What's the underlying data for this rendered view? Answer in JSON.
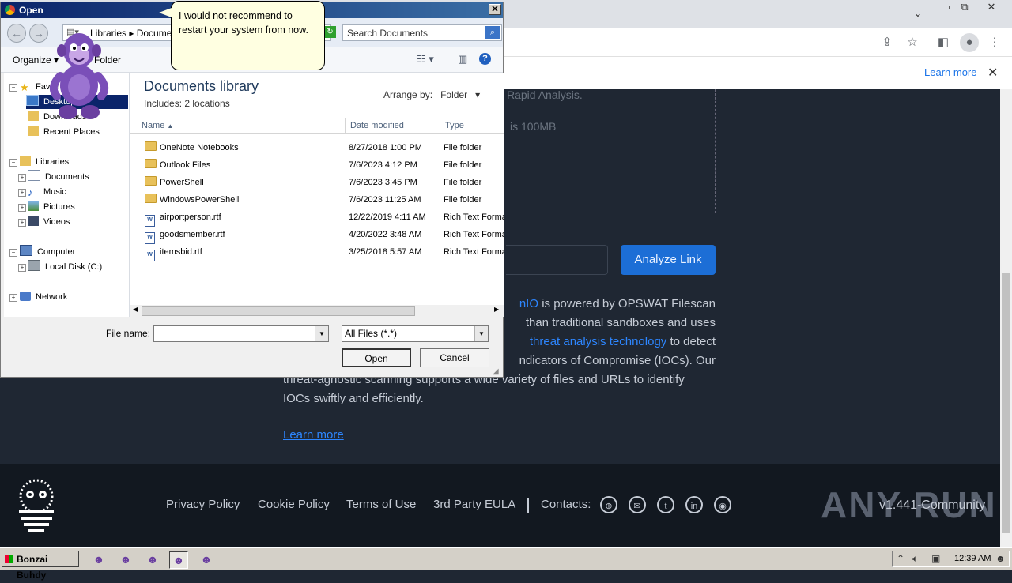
{
  "browser": {
    "banner_link": "Learn more"
  },
  "page": {
    "drop_text_1": "Rapid Analysis.",
    "drop_text_2": "is 100MB",
    "analyze_button": "Analyze Link",
    "para_line1_link": "nIO",
    "para_line1_rest": " is powered by OPSWAT Filescan",
    "para_line2": "than traditional sandboxes and uses",
    "para_line3_link": "threat analysis technology",
    "para_line3_rest": " to detect",
    "para_line4": "ndicators of Compromise (IOCs). Our",
    "para_line5": "threat-agnostic scanning supports a wide variety of files and URLs to identify",
    "para_line6": "IOCs swiftly and efficiently.",
    "learn_more": "Learn more"
  },
  "footer": {
    "links": [
      "Privacy Policy",
      "Cookie Policy",
      "Terms of Use",
      "3rd Party EULA"
    ],
    "contacts_label": "Contacts:",
    "brand": "ANY RUN",
    "version": "v1.441-Community"
  },
  "dialog": {
    "title": "Open",
    "breadcrumb": "Libraries ▸ Documents",
    "search_placeholder": "Search Documents",
    "organize": "Organize ▾",
    "new_folder": "Folder",
    "library_title": "Documents library",
    "library_sub": "Includes:  2 locations",
    "arrange_label": "Arrange by:",
    "arrange_value": "Folder",
    "columns": [
      "Name",
      "Date modified",
      "Type"
    ],
    "files": [
      {
        "name": "OneNote Notebooks",
        "date": "8/27/2018 1:00 PM",
        "type": "File folder",
        "kind": "folder"
      },
      {
        "name": "Outlook Files",
        "date": "7/6/2023 4:12 PM",
        "type": "File folder",
        "kind": "folder"
      },
      {
        "name": "PowerShell",
        "date": "7/6/2023 3:45 PM",
        "type": "File folder",
        "kind": "folder"
      },
      {
        "name": "WindowsPowerShell",
        "date": "7/6/2023 11:25 AM",
        "type": "File folder",
        "kind": "folder"
      },
      {
        "name": "airportperson.rtf",
        "date": "12/22/2019 4:11 AM",
        "type": "Rich Text Forma",
        "kind": "rtf"
      },
      {
        "name": "goodsmember.rtf",
        "date": "4/20/2022 3:48 AM",
        "type": "Rich Text Forma",
        "kind": "rtf"
      },
      {
        "name": "itemsbid.rtf",
        "date": "3/25/2018 5:57 AM",
        "type": "Rich Text Forma",
        "kind": "rtf"
      }
    ],
    "tree": {
      "favorites": "Favorites",
      "desktop": "Desktop",
      "downloads": "Downloads",
      "recent": "Recent Places",
      "libraries": "Libraries",
      "documents": "Documents",
      "music": "Music",
      "pictures": "Pictures",
      "videos": "Videos",
      "computer": "Computer",
      "local_disk": "Local Disk (C:)",
      "network": "Network"
    },
    "file_name_label": "File name:",
    "file_name_value": "",
    "file_type": "All Files (*.*)",
    "open_button": "Open",
    "cancel_button": "Cancel"
  },
  "bubble": {
    "text": "I would not recommend to restart your system from now."
  },
  "taskbar": {
    "start_label": "Bonzai Buhdy",
    "clock": "12:39 AM"
  }
}
